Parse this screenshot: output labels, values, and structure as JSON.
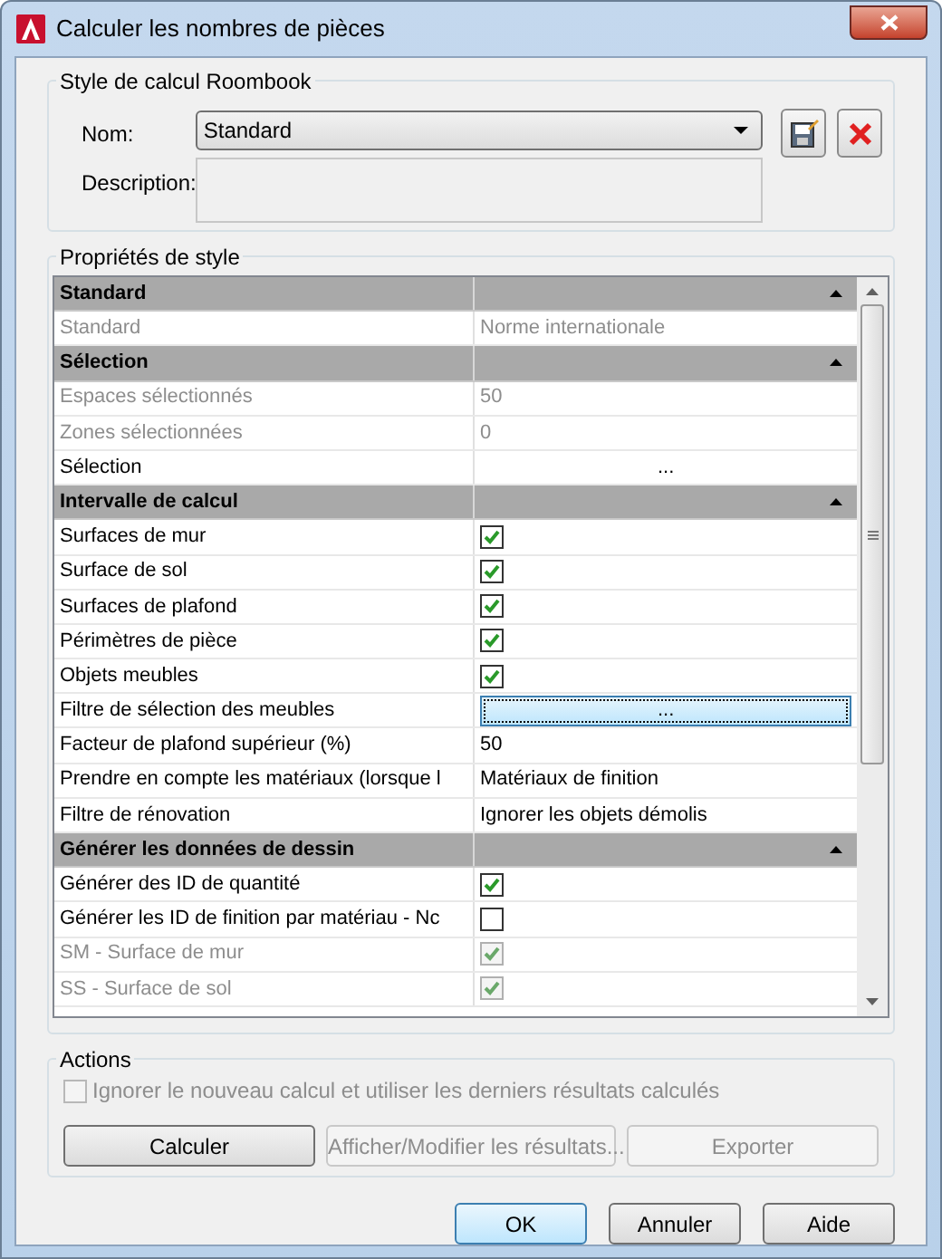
{
  "window": {
    "title": "Calculer les nombres de pièces"
  },
  "style_group": {
    "title": "Style de calcul Roombook",
    "name_label": "Nom:",
    "name_value": "Standard",
    "description_label": "Description:"
  },
  "properties": {
    "title": "Propriétés de style",
    "rows": [
      {
        "kind": "header",
        "label": "Standard",
        "expanded": true
      },
      {
        "kind": "text",
        "label": "Standard",
        "value": "Norme internationale",
        "disabled": true
      },
      {
        "kind": "header",
        "label": "Sélection",
        "expanded": true
      },
      {
        "kind": "text",
        "label": "Espaces sélectionnés",
        "value": "50",
        "disabled": true
      },
      {
        "kind": "text",
        "label": "Zones sélectionnées",
        "value": "0",
        "disabled": true
      },
      {
        "kind": "ellipsis",
        "label": "Sélection",
        "value": "...",
        "disabled": false,
        "focused": false
      },
      {
        "kind": "header",
        "label": "Intervalle de calcul",
        "expanded": true
      },
      {
        "kind": "checkbox",
        "label": "Surfaces de mur",
        "checked": true,
        "disabled": false
      },
      {
        "kind": "checkbox",
        "label": "Surface de sol",
        "checked": true,
        "disabled": false
      },
      {
        "kind": "checkbox",
        "label": "Surfaces de plafond",
        "checked": true,
        "disabled": false
      },
      {
        "kind": "checkbox",
        "label": "Périmètres de pièce",
        "checked": true,
        "disabled": false
      },
      {
        "kind": "checkbox",
        "label": "Objets meubles",
        "checked": true,
        "disabled": false
      },
      {
        "kind": "ellipsis",
        "label": "Filtre de sélection des meubles",
        "value": "...",
        "disabled": false,
        "focused": true
      },
      {
        "kind": "text",
        "label": "Facteur de plafond supérieur (%)",
        "value": "50",
        "disabled": false
      },
      {
        "kind": "text",
        "label": "Prendre en compte les matériaux (lorsque l",
        "value": "Matériaux de finition",
        "disabled": false
      },
      {
        "kind": "text",
        "label": "Filtre de rénovation",
        "value": "Ignorer les objets démolis",
        "disabled": false
      },
      {
        "kind": "header",
        "label": "Générer les données de dessin",
        "expanded": true
      },
      {
        "kind": "checkbox",
        "label": "Générer des ID de quantité",
        "checked": true,
        "disabled": false
      },
      {
        "kind": "checkbox",
        "label": "Générer les ID de finition par matériau - Nc",
        "checked": false,
        "disabled": false
      },
      {
        "kind": "checkbox",
        "label": "SM - Surface de mur",
        "checked": true,
        "disabled": true
      },
      {
        "kind": "checkbox",
        "label": "SS - Surface de sol",
        "checked": true,
        "disabled": true
      }
    ]
  },
  "actions": {
    "title": "Actions",
    "ignore_checkbox": {
      "label": "Ignorer le nouveau calcul et utiliser les derniers résultats calculés",
      "checked": false,
      "disabled": true
    },
    "buttons": [
      {
        "label": "Calculer",
        "disabled": false
      },
      {
        "label": "Afficher/Modifier les résultats...",
        "disabled": true
      },
      {
        "label": "Exporter",
        "disabled": true
      }
    ]
  },
  "footer_buttons": [
    {
      "label": "OK",
      "default": true
    },
    {
      "label": "Annuler",
      "default": false
    },
    {
      "label": "Aide",
      "default": false
    }
  ]
}
